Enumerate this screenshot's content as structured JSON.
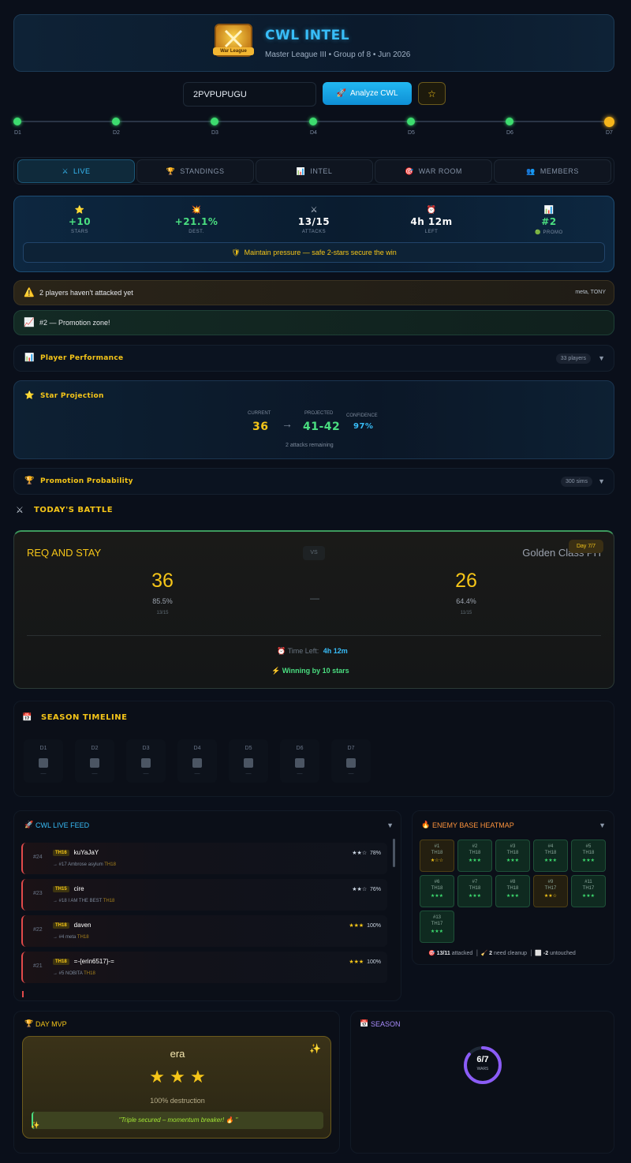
{
  "header": {
    "title": "CWL INTEL",
    "subtitle": "Master League III • Group of 8 • Jun 2026",
    "logo_text": "War League"
  },
  "search": {
    "value": "2PVPUPUGU",
    "analyze_label": "Analyze CWL"
  },
  "days": [
    "D1",
    "D2",
    "D3",
    "D4",
    "D5",
    "D6",
    "D7"
  ],
  "tabs": [
    "LIVE",
    "STANDINGS",
    "INTEL",
    "WAR ROOM",
    "MEMBERS"
  ],
  "stats": [
    {
      "value": "+10",
      "label": "STARS"
    },
    {
      "value": "+21.1%",
      "label": "DEST."
    },
    {
      "value": "13/15",
      "label": "ATTACKS"
    },
    {
      "value": "4h 12m",
      "label": "LEFT"
    },
    {
      "value": "#2",
      "label": "PROMO"
    }
  ],
  "pressure_msg": "Maintain pressure — safe 2-stars secure the win",
  "alerts": {
    "not_attacked": "2 players haven't attacked yet",
    "not_attacked_names": "meta, TONY",
    "promotion": "#2 — Promotion zone!"
  },
  "player_performance": {
    "title": "Player Performance",
    "count": "33 players"
  },
  "projection": {
    "title": "Star Projection",
    "current_label": "CURRENT",
    "current": "36",
    "projected_label": "PROJECTED",
    "projected": "41-42",
    "confidence_label": "CONFIDENCE",
    "confidence": "97%",
    "remaining": "2 attacks remaining"
  },
  "promotion_prob": {
    "title": "Promotion Probability",
    "sims": "300 sims"
  },
  "battle": {
    "section_title": "TODAY'S BATTLE",
    "day_badge": "Day 7/7",
    "our_name": "REQ AND STAY",
    "our_stars": "36",
    "our_dest": "85.5%",
    "our_attacks": "13/15",
    "vs": "VS",
    "their_name": "Golden Class PH",
    "their_stars": "26",
    "their_dest": "64.4%",
    "their_attacks": "11/15",
    "dash": "—",
    "time_left_label": "Time Left:",
    "time_left": "4h 12m",
    "status": "Winning by 10 stars"
  },
  "season_timeline": {
    "title": "SEASON TIMELINE",
    "days": [
      "D1",
      "D2",
      "D3",
      "D4",
      "D5",
      "D6",
      "D7"
    ],
    "dash": "—"
  },
  "feed": {
    "title": "CWL LIVE FEED",
    "items": [
      {
        "num": "#24",
        "th": "TH16",
        "name": "kuYaJaY",
        "target": "→ #17 Ambrose asylum",
        "target_th": "TH18",
        "stars": "★★☆",
        "pct": "78%"
      },
      {
        "num": "#23",
        "th": "TH15",
        "name": "cire",
        "target": "→ #18 I AM THE BEST",
        "target_th": "TH18",
        "stars": "★★☆",
        "pct": "76%"
      },
      {
        "num": "#22",
        "th": "TH18",
        "name": "daven",
        "target": "→ #4 meta",
        "target_th": "TH18",
        "stars": "★★★",
        "pct": "100%"
      },
      {
        "num": "#21",
        "th": "TH18",
        "name": "=-{erin6517}-=",
        "target": "→ #5 NOBITA",
        "target_th": "TH18",
        "stars": "★★★",
        "pct": "100%"
      }
    ]
  },
  "heatmap": {
    "title": "ENEMY BASE HEATMAP",
    "cells": [
      {
        "n": "#1",
        "th": "TH18",
        "s": "★☆☆",
        "c": "y"
      },
      {
        "n": "#2",
        "th": "TH18",
        "s": "★★★",
        "c": "g"
      },
      {
        "n": "#3",
        "th": "TH18",
        "s": "★★★",
        "c": "g"
      },
      {
        "n": "#4",
        "th": "TH18",
        "s": "★★★",
        "c": "g"
      },
      {
        "n": "#5",
        "th": "TH18",
        "s": "★★★",
        "c": "g"
      },
      {
        "n": "#6",
        "th": "TH18",
        "s": "★★★",
        "c": "g"
      },
      {
        "n": "#7",
        "th": "TH18",
        "s": "★★★",
        "c": "g"
      },
      {
        "n": "#8",
        "th": "TH18",
        "s": "★★★",
        "c": "g"
      },
      {
        "n": "#9",
        "th": "TH17",
        "s": "★★☆",
        "c": "y"
      },
      {
        "n": "#11",
        "th": "TH17",
        "s": "★★★",
        "c": "g"
      },
      {
        "n": "#13",
        "th": "TH17",
        "s": "★★★",
        "c": "g"
      }
    ],
    "attacked": "13/11",
    "attacked_label": "attacked",
    "cleanup": "2",
    "cleanup_label": "need cleanup",
    "untouched": "-2",
    "untouched_label": "untouched"
  },
  "mvp": {
    "title": "DAY MVP",
    "name": "era",
    "stars": "★ ★ ★",
    "destruction": "100% destruction",
    "quote": "\"Triple secured – momentum breaker! 🔥 \""
  },
  "season": {
    "title": "SEASON",
    "wars": "6/7",
    "wars_label": "WARS",
    "progress": 0.857
  },
  "colors": {
    "accent": "#38bdf8",
    "gold": "#f5c518",
    "green": "#4ade80",
    "red": "#e24a4a"
  }
}
